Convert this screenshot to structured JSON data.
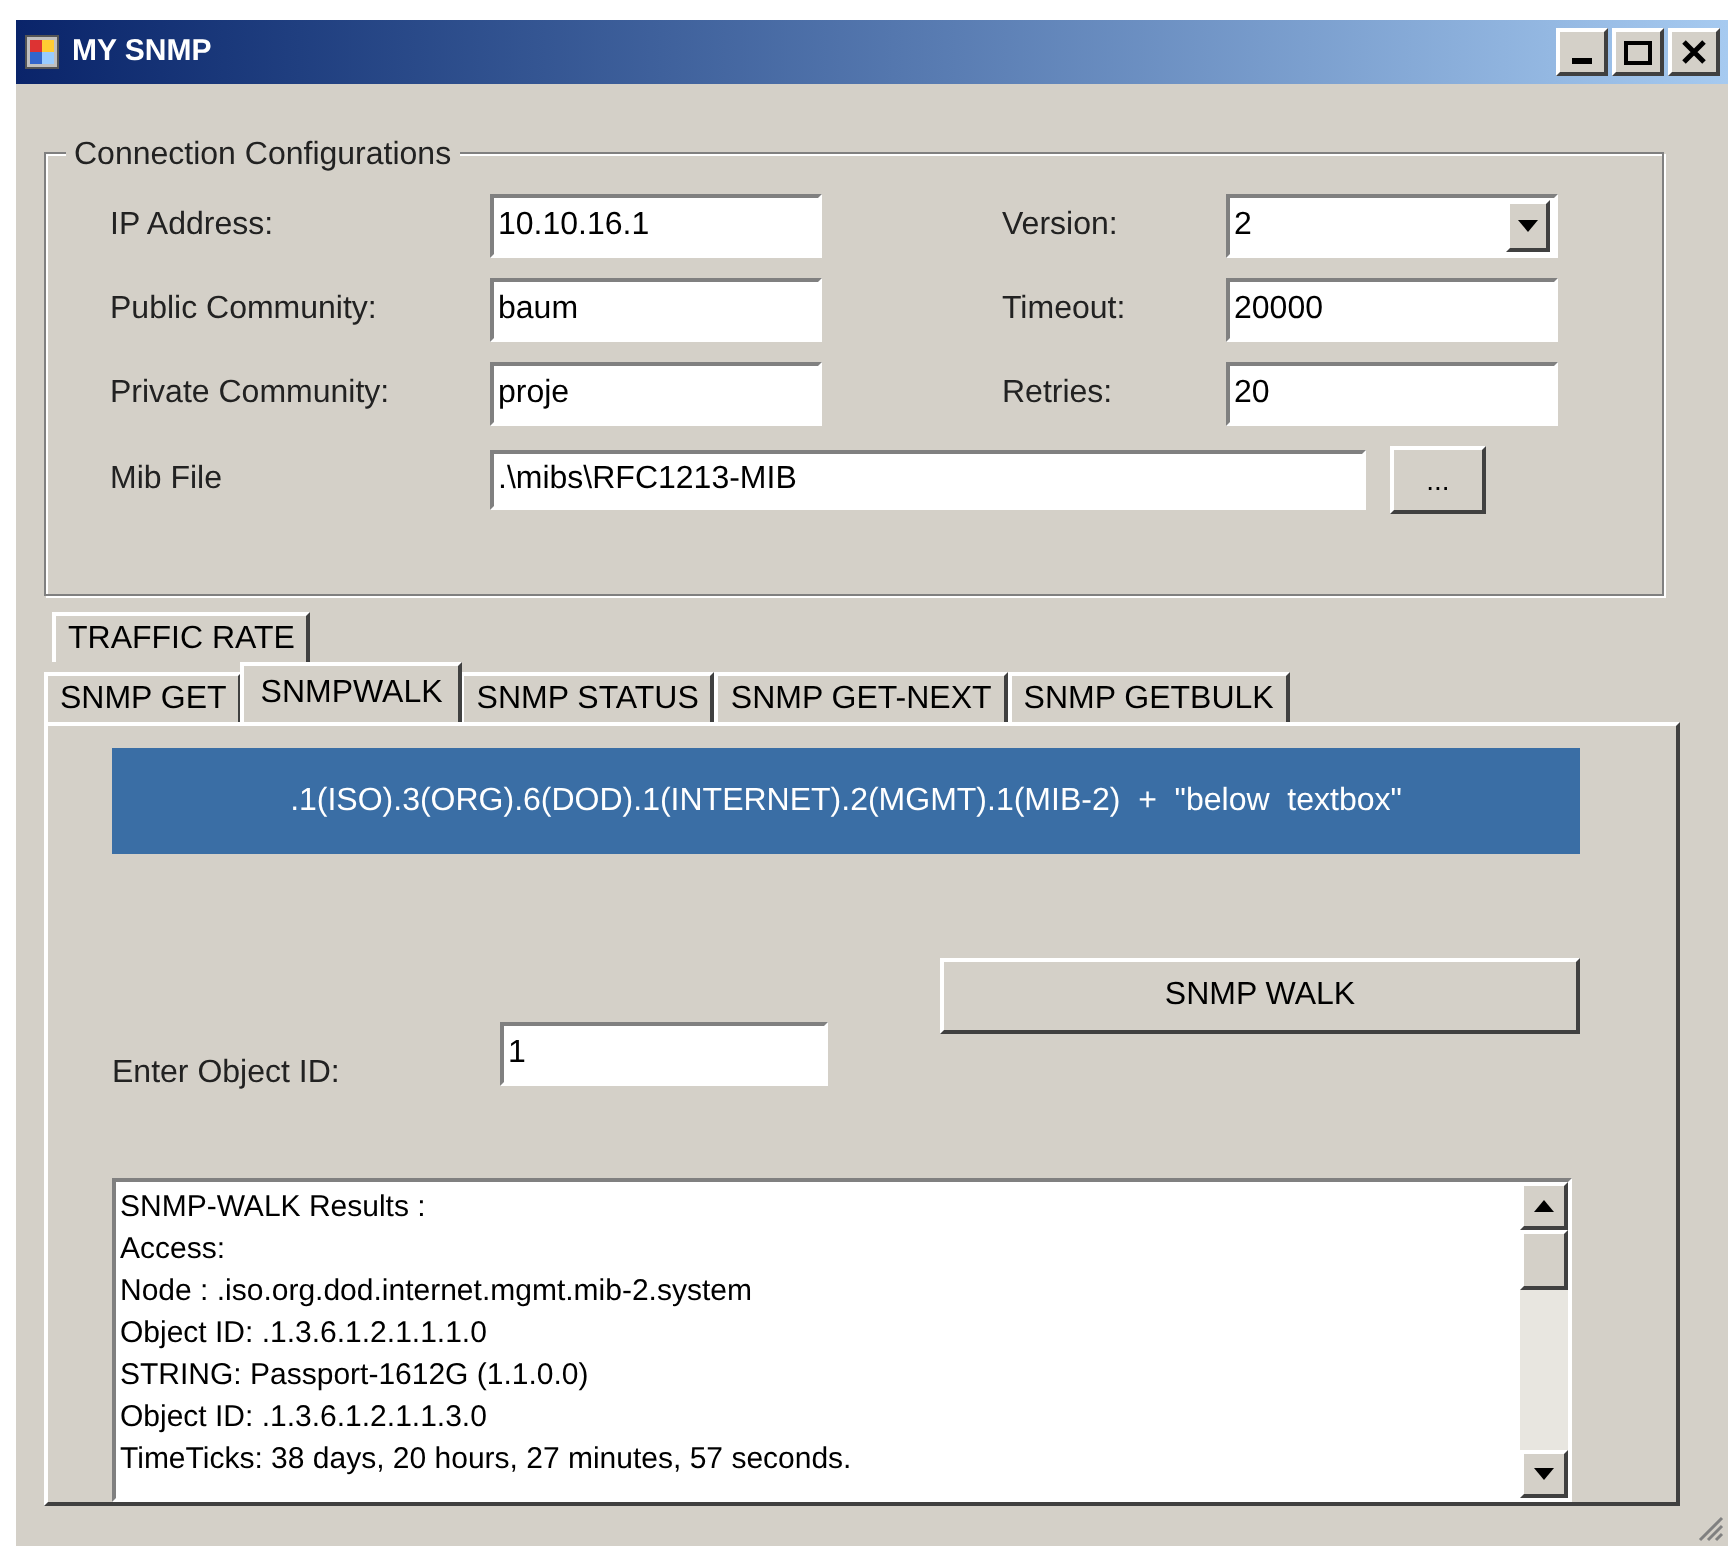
{
  "window": {
    "title": "MY SNMP"
  },
  "connection": {
    "title": "Connection Configurations",
    "fields": [
      {
        "label": "IP Address:",
        "value": "10.10.16.1"
      },
      {
        "label": "Version:",
        "value": "2",
        "kind": "dropdown"
      },
      {
        "label": "Public Community:",
        "value": "baum"
      },
      {
        "label": "Timeout:",
        "value": "20000"
      },
      {
        "label": "Private Community:",
        "value": "proje"
      },
      {
        "label": "Retries:",
        "value": "20"
      }
    ],
    "mib_file": {
      "label": "Mib File",
      "value": ".\\mibs\\RFC1213-MIB",
      "button": "..."
    }
  },
  "tab_rows": [
    [
      {
        "label": "TRAFFIC RATE",
        "selected": false
      }
    ],
    [
      {
        "label": "SNMP GET",
        "selected": false
      },
      {
        "label": "SNMPWALK",
        "selected": true
      },
      {
        "label": "SNMP STATUS",
        "selected": false
      },
      {
        "label": "SNMP GET-NEXT",
        "selected": false
      },
      {
        "label": "SNMP GETBULK",
        "selected": false
      }
    ]
  ],
  "walk": {
    "banner": ".1(ISO).3(ORG).6(DOD).1(INTERNET).2(MGMT).1(MIB-2)  +  \"below  textbox\"",
    "object_id_label": "Enter Object ID:",
    "object_id": "1",
    "button": "SNMP WALK",
    "results": [
      "SNMP-WALK Results :",
      "Access:",
      "Node  :  .iso.org.dod.internet.mgmt.mib-2.system",
      "Object ID: .1.3.6.1.2.1.1.1.0",
      "STRING: Passport-1612G (1.1.0.0)",
      "Object ID: .1.3.6.1.2.1.1.3.0",
      "TimeTicks: 38 days, 20 hours, 27 minutes, 57 seconds."
    ]
  }
}
